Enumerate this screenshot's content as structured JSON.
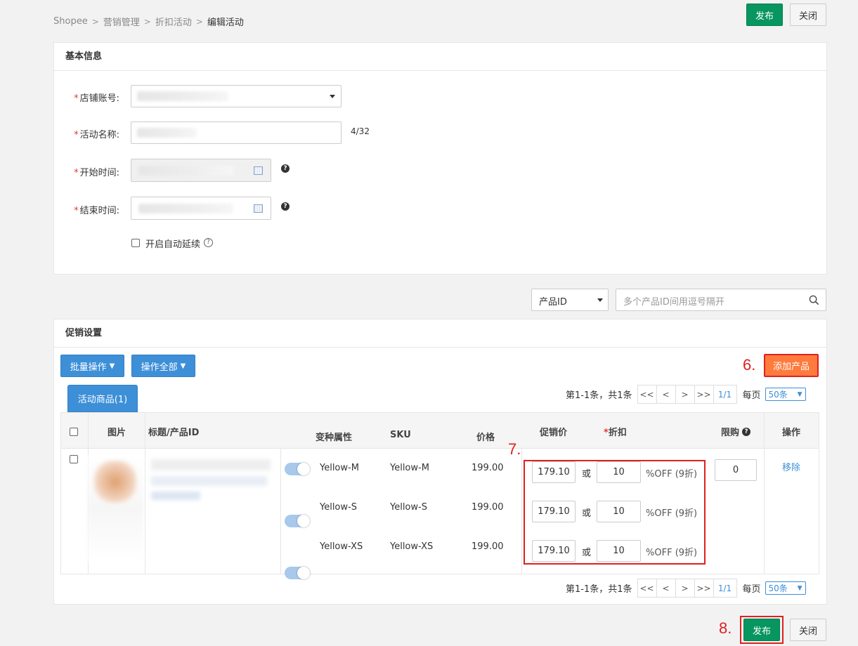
{
  "breadcrumb": [
    "Shopee",
    "营销管理",
    "折扣活动",
    "编辑活动"
  ],
  "header": {
    "publish_label": "发布",
    "close_label": "关闭"
  },
  "basic": {
    "title": "基本信息",
    "shop_label": "店铺账号:",
    "name_label": "活动名称:",
    "name_count": "4/32",
    "start_label": "开始时间:",
    "end_label": "结束时间:",
    "auto_extend_label": "开启自动延续"
  },
  "search": {
    "type_value": "产品ID",
    "placeholder": "多个产品ID间用逗号隔开"
  },
  "promo": {
    "title": "促销设置",
    "batch_label": "批量操作",
    "all_label": "操作全部",
    "add_label": "添加产品",
    "tab_label": "活动商品(1)",
    "pager": {
      "summary": "第1-1条，共1条",
      "first": "<<",
      "prev": "<",
      "next": ">",
      "last": ">>",
      "page": "1/1",
      "per_page_label": "每页",
      "per_page_value": "50条"
    },
    "columns": {
      "image": "图片",
      "title": "标题/产品ID",
      "variant": "变种属性",
      "sku": "SKU",
      "price": "价格",
      "promo_price": "促销价",
      "discount": "折扣",
      "limit": "限购",
      "action": "操作"
    },
    "rows": [
      {
        "variant": "Yellow-M",
        "sku": "Yellow-M",
        "price": "199.00",
        "promo_price": "179.10",
        "or": "或",
        "discount": "10",
        "off": "%OFF",
        "zhe": "(9折)"
      },
      {
        "variant": "Yellow-S",
        "sku": "Yellow-S",
        "price": "199.00",
        "promo_price": "179.10",
        "or": "或",
        "discount": "10",
        "off": "%OFF",
        "zhe": "(9折)"
      },
      {
        "variant": "Yellow-XS",
        "sku": "Yellow-XS",
        "price": "199.00",
        "promo_price": "179.10",
        "or": "或",
        "discount": "10",
        "off": "%OFF",
        "zhe": "(9折)"
      }
    ],
    "limit_value": "0",
    "remove_label": "移除"
  },
  "steps": {
    "s6": "6.",
    "s7": "7.",
    "s8": "8."
  },
  "colors": {
    "green": "#079560",
    "blue": "#3d8fd8",
    "orange": "#ff7a3d",
    "annotation_red": "#e02020"
  }
}
